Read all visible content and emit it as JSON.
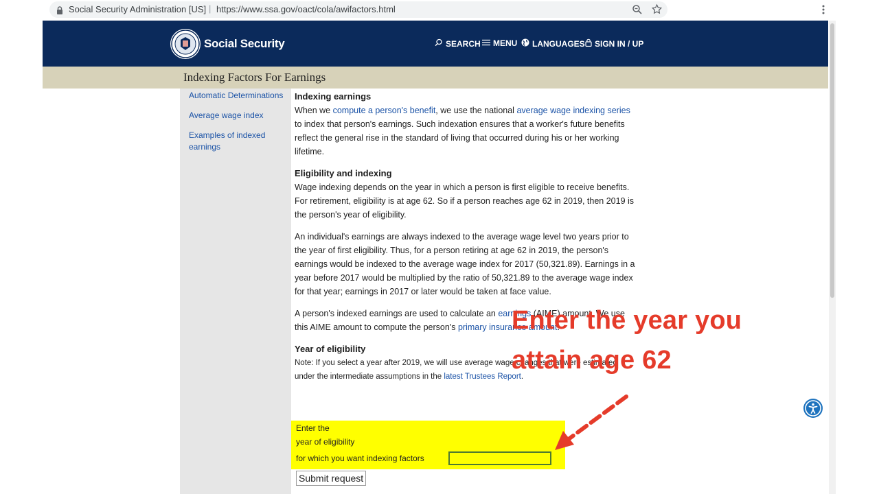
{
  "browser": {
    "site_name": "Social Security Administration [US]",
    "url": "https://www.ssa.gov/oact/cola/awifactors.html",
    "separator": "|"
  },
  "header": {
    "brand": "Social Security",
    "nav": {
      "search": "SEARCH",
      "menu": "MENU",
      "languages": "LANGUAGES",
      "signin": "SIGN IN / UP"
    }
  },
  "page_title": "Indexing Factors For Earnings",
  "sidebar": {
    "items": [
      {
        "label": "Automatic Determinations"
      },
      {
        "label": "Average wage index"
      },
      {
        "label": "Examples of indexed earnings"
      }
    ]
  },
  "content": {
    "s1": {
      "heading": "Indexing earnings",
      "t1": "When we ",
      "l1": "compute a person's benefit",
      "t2": ", we use the national ",
      "l2": "average wage indexing series",
      "t3": " to index that person's earnings. Such indexation ensures that a worker's future benefits reflect the general rise in the standard of living that occurred during his or her working lifetime."
    },
    "s2": {
      "heading": "Eligibility and indexing",
      "p1": "Wage indexing depends on the year in which a person is first eligible to receive benefits. For retirement, eligibility is at age 62. So if a person reaches age 62 in 2019, then 2019 is the person's year of eligibility.",
      "p2": "An individual's earnings are always indexed to the average wage level two years prior to the year of first eligibility. Thus, for a person retiring at age 62 in 2019, the person's earnings would be indexed to the average wage index for 2017 (50,321.89). Earnings in a year before 2017 would be multiplied by the ratio of 50,321.89 to the average wage index for that year; earnings in 2017 or later would be taken at face value.",
      "p3_t1": "A person's indexed earnings are used to calculate an ",
      "p3_l1": "earnings",
      "p3_t2": " (AIME) amount. We use this AIME amount to compute the person's ",
      "p3_l2": "primary insurance amount",
      "p3_t3": "."
    },
    "s3": {
      "heading": "Year of eligibility",
      "note_t1": "Note: If you select a year after 2019, we will use average wage changes that were estimated under the intermediate assumptions in the ",
      "note_link": "latest Trustees Report",
      "note_t2": "."
    }
  },
  "form": {
    "line1": "Enter the",
    "line2": "year of eligibility",
    "line3": "for which you want indexing factors",
    "input_value": "",
    "submit": "Submit request"
  },
  "overlay": {
    "line1": "Enter the year you",
    "line2": "attain age 62"
  },
  "colors": {
    "header_bg": "#0b2a5b",
    "title_bar_bg": "#d7d2b9",
    "link": "#1a52a6",
    "highlight": "#ffff00",
    "annotation": "#e53b2a"
  }
}
